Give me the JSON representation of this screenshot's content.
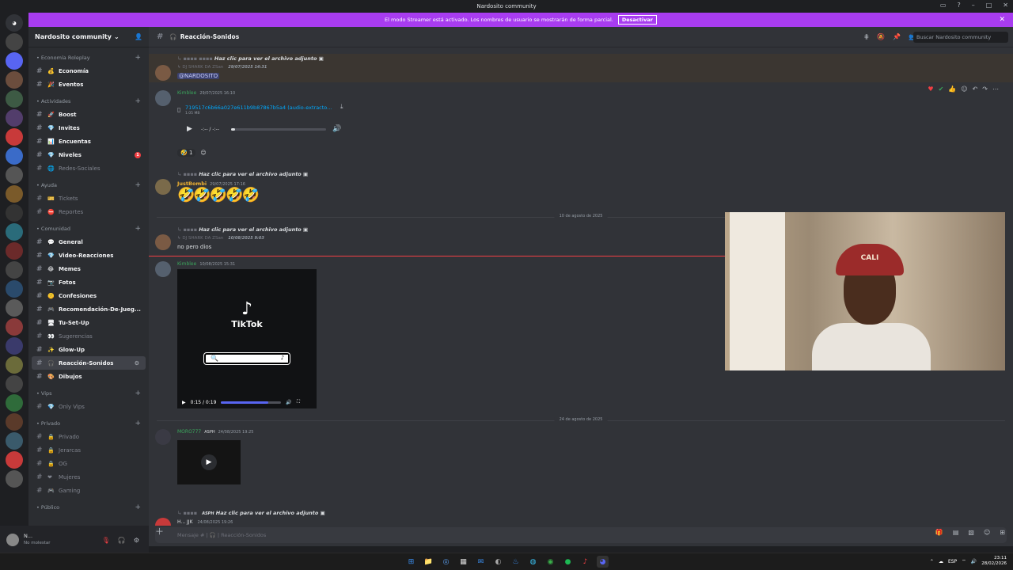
{
  "window": {
    "title": "Nardosito community"
  },
  "banner": {
    "text": "El modo Streamer está activado. Los nombres de usuario se mostrarán de forma parcial.",
    "button": "Desactivar"
  },
  "guild": {
    "name": "Nardosito community"
  },
  "sidebar": {
    "categories": [
      {
        "name": "• Economía Roleplay",
        "channels": [
          {
            "emoji": "💰",
            "name": "Economía",
            "bold": true
          },
          {
            "emoji": "🎉",
            "name": "Eventos",
            "bold": true
          }
        ]
      },
      {
        "name": "• Actividades",
        "channels": [
          {
            "emoji": "🚀",
            "name": "Boost",
            "bold": true
          },
          {
            "emoji": "💎",
            "name": "Invites",
            "bold": true
          },
          {
            "emoji": "📊",
            "name": "Encuentas",
            "bold": true
          },
          {
            "emoji": "💎",
            "name": "Niveles",
            "bold": true,
            "badge": "1"
          },
          {
            "emoji": "🌐",
            "name": "Redes-Sociales",
            "bold": false
          }
        ]
      },
      {
        "name": "• Ayuda",
        "channels": [
          {
            "emoji": "🎫",
            "name": "Tickets",
            "bold": false
          },
          {
            "emoji": "⛔",
            "name": "Reportes",
            "bold": false
          }
        ]
      },
      {
        "name": "• Comunidad",
        "channels": [
          {
            "emoji": "💬",
            "name": "General",
            "bold": true
          },
          {
            "emoji": "💎",
            "name": "Video-Reacciones",
            "bold": true
          },
          {
            "emoji": "😂",
            "name": "Memes",
            "bold": true
          },
          {
            "emoji": "📷",
            "name": "Fotos",
            "bold": true
          },
          {
            "emoji": "🤫",
            "name": "Confesiones",
            "bold": true
          },
          {
            "emoji": "🎮",
            "name": "Recomendación-De-Jueg...",
            "bold": true
          },
          {
            "emoji": "🖥",
            "name": "Tu-Set-Up",
            "bold": true
          },
          {
            "emoji": "👀",
            "name": "Sugerencias",
            "bold": false
          },
          {
            "emoji": "✨",
            "name": "Glow-Up",
            "bold": true
          },
          {
            "emoji": "🎧",
            "name": "Reacción-Sonidos",
            "bold": true,
            "selected": true
          },
          {
            "emoji": "🎨",
            "name": "Dibujos",
            "bold": true
          }
        ]
      },
      {
        "name": "• Vips",
        "channels": [
          {
            "emoji": "💎",
            "name": "Only Vips",
            "bold": false
          }
        ]
      },
      {
        "name": "• Privado",
        "channels": [
          {
            "emoji": "🔒",
            "name": "Privado",
            "bold": false
          },
          {
            "emoji": "🔒",
            "name": "Jerarcas",
            "bold": false
          },
          {
            "emoji": "🔒",
            "name": "OG",
            "bold": false
          },
          {
            "emoji": "❤",
            "name": "Mujeres",
            "bold": false
          },
          {
            "emoji": "🎮",
            "name": "Gaming",
            "bold": false
          }
        ]
      },
      {
        "name": "• Público",
        "channels": []
      }
    ]
  },
  "user": {
    "name": "N...",
    "status": "No molestar"
  },
  "channel": {
    "name": "Reacción-Sonidos",
    "search_placeholder": "Buscar Nardosito community"
  },
  "messages": {
    "m1": {
      "reply": "Haz clic para ver el archivo adjunto",
      "reply2": "DJ SHARK DA ZSan",
      "time": "29/07/2025 14:31",
      "mention": "@NARDOSITO"
    },
    "m2": {
      "user": "Kimblee",
      "time": "29/07/2025 16:10",
      "file": "719517c6b66a027e611b9b87867b5a4 (audio-extracto...",
      "size": "1.05 MB",
      "time_display": "-:-- / -:--",
      "react_count": "1"
    },
    "m3": {
      "reply": "Haz clic para ver el archivo adjunto",
      "user": "JustBombi",
      "time": "29/07/2025 17:16",
      "emojis": "🤣🤣🤣🤣🤣"
    },
    "divider1": "10 de agosto de 2025",
    "m4": {
      "reply": "Haz clic para ver el archivo adjunto",
      "reply2": "DJ SHARK DA ZSan",
      "time": "10/08/2025 9:03",
      "text": "no pero dios"
    },
    "m5": {
      "user": "Kimblee",
      "time": "10/08/2025 15:31",
      "brand": "TikTok",
      "video_time": "0:15 / 0:19",
      "video_progress": 0.78
    },
    "divider2": "24 de agosto de 2025",
    "m6": {
      "user": "MORO777",
      "tag": "ASPH",
      "time": "24/08/2025 19:25"
    },
    "m7": {
      "reply": "Haz clic para ver el archivo adjunto",
      "tag": "ASPH",
      "text": "H... JJK",
      "time": "24/08/2025 19:26"
    }
  },
  "compose": {
    "placeholder": "Mensaje # | 🎧 | Reacción-Sonidos"
  },
  "webcam": {
    "cap_text": "CALI"
  },
  "taskbar": {
    "lang": "ESP",
    "time": "23:11",
    "date": "28/02/2026"
  },
  "colors": {
    "accent": "#a83cf0",
    "mention": "#5865f2"
  }
}
